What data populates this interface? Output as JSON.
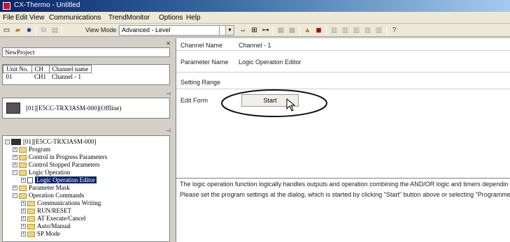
{
  "window": {
    "title": "CX-Thermo - Untitled"
  },
  "menu": [
    "File",
    "Edit",
    "View",
    "Communications",
    "TrendMonitor",
    "Options",
    "Help"
  ],
  "toolbar": {
    "view_mode_label": "View Mode :",
    "view_mode_value": "Advanced - Level"
  },
  "project": {
    "name": "NewProject"
  },
  "grid": {
    "headers": [
      "Unit No.",
      "CH",
      "Channel name"
    ],
    "row": [
      "01",
      "CH1",
      "Channel - 1"
    ]
  },
  "unit": {
    "label": "[01][E5CC-TRX3ASM-000](Offline)"
  },
  "tree": {
    "root": "[01][E5CC-TRX3ASM-000]",
    "items": [
      "Program",
      "Control in Progress Parameters",
      "Control Stopped Parameters",
      "Logic Operation",
      "Logic Operation Editor",
      "Parameter Mask",
      "Operation Commands",
      "Communications Writing",
      "RUN/RESET",
      "AT Execute/Cancel",
      "Auto/Manual",
      "SP Mode"
    ]
  },
  "details": {
    "channel_name_label": "Channel Name",
    "channel_name_value": "Channel - 1",
    "parameter_name_label": "Parameter Name",
    "parameter_name_value": "Logic Operation Editor",
    "setting_range_label": "Setting Range",
    "edit_form_label": "Edit Form",
    "start_button": "Start"
  },
  "description": [
    "The logic operation function logically handles outputs and operation combining the AND/OR logic and timers dependin",
    "Please set the program settings at the dialog, which is started by clicking \"Start\" button above or selecting \"Programme"
  ],
  "colors": {
    "selection": "#0a246a",
    "titlebar": "#0a246a"
  }
}
